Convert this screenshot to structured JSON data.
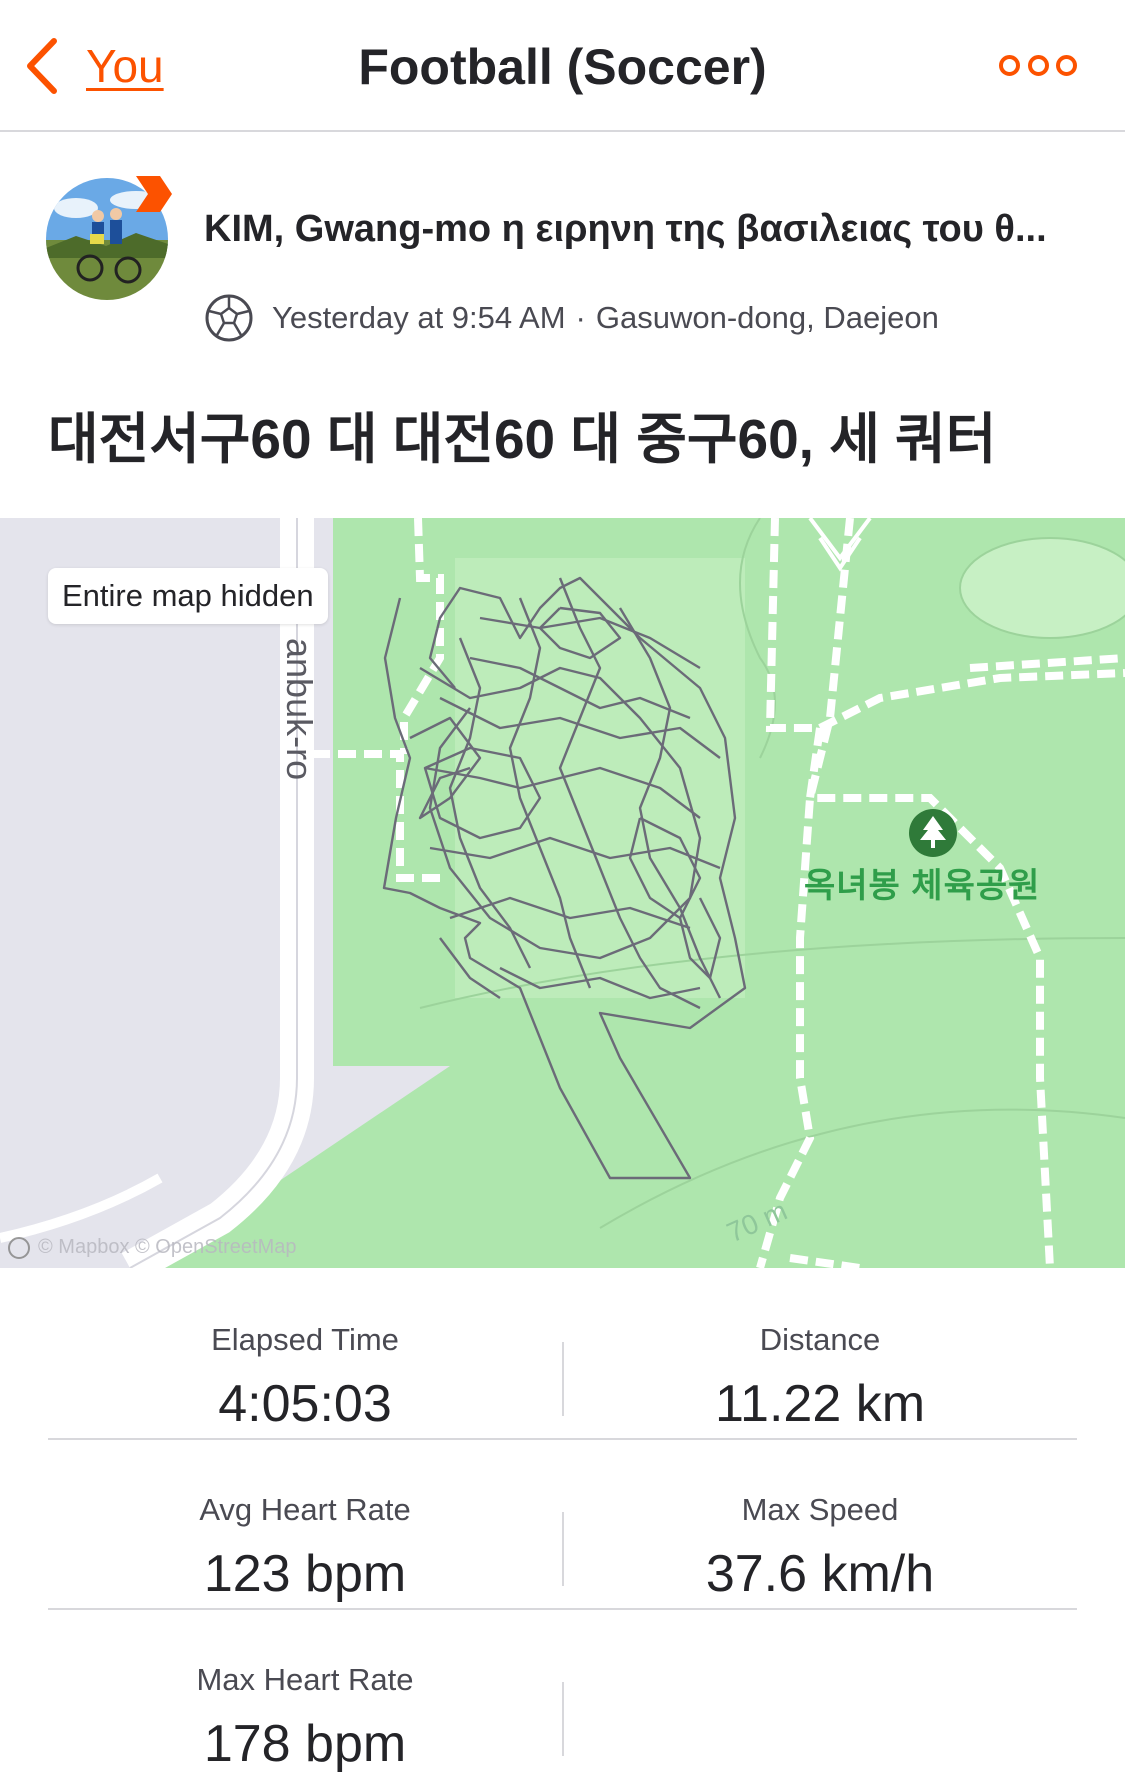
{
  "header": {
    "back_label": "You",
    "title": "Football (Soccer)",
    "accent_color": "#fc5200"
  },
  "athlete": {
    "name": "KIM, Gwang-mo η ειρηνη της βασιλειας του θ...",
    "timestamp": "Yesterday at 9:54 AM",
    "separator": "·",
    "location": "Gasuwon-dong, Daejeon",
    "sport_icon": "soccer-ball-icon"
  },
  "activity": {
    "title": "대전서구60 대 대전60 대 중구60, 세 쿼터"
  },
  "map": {
    "privacy_chip": "Entire map hidden",
    "road_label": "anbuk-ro",
    "park_label": "옥녀봉 체육공원",
    "contour_label": "70 m",
    "attribution": "© Mapbox © OpenStreetMap",
    "park_color": "#aee6ad",
    "route_color": "#6b6b78"
  },
  "stats": [
    {
      "label": "Elapsed Time",
      "value": "4:05:03"
    },
    {
      "label": "Distance",
      "value": "11.22 km"
    },
    {
      "label": "Avg Heart Rate",
      "value": "123 bpm"
    },
    {
      "label": "Max Speed",
      "value": "37.6 km/h"
    },
    {
      "label": "Max Heart Rate",
      "value": "178 bpm"
    }
  ]
}
